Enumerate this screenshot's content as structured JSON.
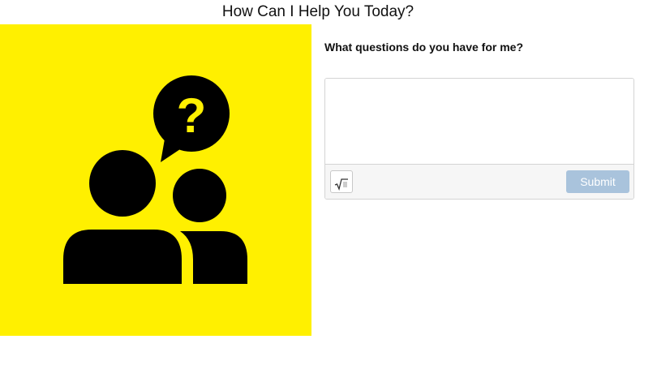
{
  "page": {
    "title": "How Can I Help You Today?"
  },
  "illustration": {
    "icon": "people-question-icon",
    "background_color": "#fff000",
    "figure_color": "#000000",
    "question_mark": "?"
  },
  "question": {
    "label": "What questions do you have for me?"
  },
  "answer": {
    "value": "",
    "placeholder": "",
    "math_icon": "square-root-icon",
    "submit_label": "Submit",
    "submit_color": "#a9c3dc"
  }
}
